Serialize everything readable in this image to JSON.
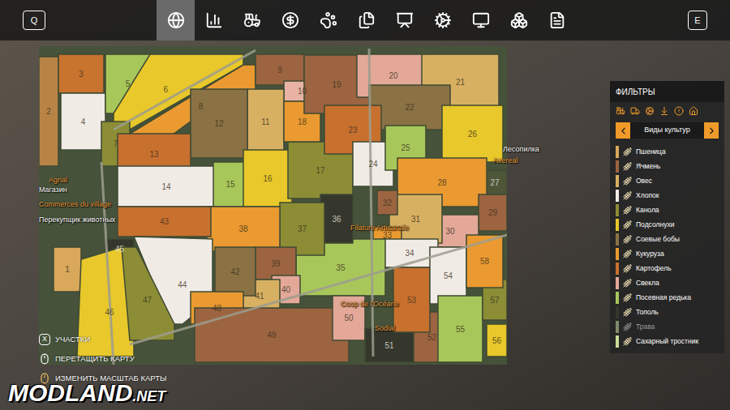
{
  "topbar": {
    "left_key": "Q",
    "right_key": "E",
    "tabs": [
      {
        "selected": true
      },
      {
        "selected": false
      },
      {
        "selected": false
      },
      {
        "selected": false
      },
      {
        "selected": false
      },
      {
        "selected": false
      },
      {
        "selected": false
      },
      {
        "selected": false
      },
      {
        "selected": false
      },
      {
        "selected": false
      },
      {
        "selected": false
      }
    ]
  },
  "map": {
    "fields": [
      {
        "label": "1",
        "color": "#d9a85a"
      },
      {
        "label": "2",
        "color": "#b88445"
      },
      {
        "label": "3",
        "color": "#c8732e"
      },
      {
        "label": "4",
        "color": "#f1ebe6"
      },
      {
        "label": "5",
        "color": "#a8c75a"
      },
      {
        "label": "6",
        "color": "#e8c82a"
      },
      {
        "label": "7",
        "color": "#8c8d35"
      },
      {
        "label": "8",
        "color": "#ea9a30"
      },
      {
        "label": "9",
        "color": "#9c6440"
      },
      {
        "label": "10",
        "color": "#e8b3a3"
      },
      {
        "label": "11",
        "color": "#d8b062"
      },
      {
        "label": "12",
        "color": "#8a7244"
      },
      {
        "label": "13",
        "color": "#c8702e"
      },
      {
        "label": "14",
        "color": "#f1ebe6"
      },
      {
        "label": "15",
        "color": "#a8c75a"
      },
      {
        "label": "16",
        "color": "#e8c82a"
      },
      {
        "label": "17",
        "color": "#8c8d35"
      },
      {
        "label": "18",
        "color": "#ea9a30"
      },
      {
        "label": "19",
        "color": "#9c6440"
      },
      {
        "label": "20",
        "color": "#e3a898"
      },
      {
        "label": "21",
        "color": "#d8b062"
      },
      {
        "label": "22",
        "color": "#8a7244"
      },
      {
        "label": "23",
        "color": "#c8702e"
      },
      {
        "label": "24",
        "color": "#f1ebe6"
      },
      {
        "label": "25",
        "color": "#a8c75a"
      },
      {
        "label": "26",
        "color": "#e8c82a"
      },
      {
        "label": "27",
        "color": "#4e5638"
      },
      {
        "label": "28",
        "color": "#ea9a30"
      },
      {
        "label": "29",
        "color": "#9c6440"
      },
      {
        "label": "30",
        "color": "#e3a898"
      },
      {
        "label": "31",
        "color": "#d8b062"
      },
      {
        "label": "32",
        "color": "#9c6440"
      },
      {
        "label": "33",
        "color": "#ea9a30"
      },
      {
        "label": "34",
        "color": "#f1ebe6"
      },
      {
        "label": "35",
        "color": "#a8c75a"
      },
      {
        "label": "36",
        "color": "#35372c"
      },
      {
        "label": "37",
        "color": "#8c8d35"
      },
      {
        "label": "38",
        "color": "#ea9a30"
      },
      {
        "label": "39",
        "color": "#9c6440"
      },
      {
        "label": "40",
        "color": "#e3a898"
      },
      {
        "label": "41",
        "color": "#d8b062"
      },
      {
        "label": "42",
        "color": "#8a7244"
      },
      {
        "label": "43",
        "color": "#c8702e"
      },
      {
        "label": "44",
        "color": "#f1ebe6"
      },
      {
        "label": "45",
        "color": "#35372c"
      },
      {
        "label": "46",
        "color": "#e8c82a"
      },
      {
        "label": "47",
        "color": "#8c8d35"
      },
      {
        "label": "48",
        "color": "#ea9a30"
      },
      {
        "label": "49",
        "color": "#9c6440"
      },
      {
        "label": "50",
        "color": "#e3a898"
      },
      {
        "label": "51",
        "color": "#35372c"
      },
      {
        "label": "52",
        "color": "#9c6440"
      },
      {
        "label": "53",
        "color": "#c8702e"
      },
      {
        "label": "54",
        "color": "#f1ebe6"
      },
      {
        "label": "55",
        "color": "#a8c75a"
      },
      {
        "label": "56",
        "color": "#e8c82a"
      },
      {
        "label": "57",
        "color": "#8c8d35"
      },
      {
        "label": "58",
        "color": "#ea9a30"
      }
    ],
    "places": [
      {
        "label": "Agrial",
        "color": "#f0a040"
      },
      {
        "label": "Магазин",
        "color": "#ffffff"
      },
      {
        "label": "Commerces du village",
        "color": "#f0a040"
      },
      {
        "label": "Перекупщик животных",
        "color": "#ffffff"
      },
      {
        "label": "Лесопилка",
        "color": "#ffffff"
      },
      {
        "label": "Axereal",
        "color": "#f0a040"
      },
      {
        "label": "Filature Artisanale",
        "color": "#f0a040"
      },
      {
        "label": "Coop de l'Océane",
        "color": "#f0a040"
      },
      {
        "label": "Sodial",
        "color": "#f0a040"
      }
    ]
  },
  "filters": {
    "title": "ФИЛЬТРЫ",
    "selector": "Виды культур",
    "crops": [
      {
        "label": "Пшеница",
        "color": "#d9a85a",
        "dimmed": false
      },
      {
        "label": "Ячмень",
        "color": "#9c6440",
        "dimmed": false
      },
      {
        "label": "Овес",
        "color": "#d8b062",
        "dimmed": false
      },
      {
        "label": "Хлопок",
        "color": "#f1ebe6",
        "dimmed": false
      },
      {
        "label": "Канола",
        "color": "#8c8d35",
        "dimmed": false
      },
      {
        "label": "Подсолнухи",
        "color": "#e8c82a",
        "dimmed": false
      },
      {
        "label": "Соевые бобы",
        "color": "#8a7244",
        "dimmed": false
      },
      {
        "label": "Кукуруза",
        "color": "#ea9a30",
        "dimmed": false
      },
      {
        "label": "Картофель",
        "color": "#c8702e",
        "dimmed": false
      },
      {
        "label": "Свекла",
        "color": "#e3a898",
        "dimmed": false
      },
      {
        "label": "Посевная редька",
        "color": "#a8c75a",
        "dimmed": false
      },
      {
        "label": "Тополь",
        "color": "#35372c",
        "dimmed": false
      },
      {
        "label": "Трава",
        "color": "#7f8a6a",
        "dimmed": true
      },
      {
        "label": "Сахарный тростник",
        "color": "#c9dc97",
        "dimmed": false
      }
    ]
  },
  "controls": [
    {
      "kind": "key",
      "key": "X",
      "label": "УЧАСТКИ"
    },
    {
      "kind": "mouse",
      "label": "ПЕРЕТАЩИТЬ КАРТУ"
    },
    {
      "kind": "wheel",
      "label": "ИЗМЕНИТЬ МАСШТАБ КАРТЫ"
    }
  ],
  "watermark": {
    "text": "MODLAND",
    "suffix": ".NET"
  }
}
